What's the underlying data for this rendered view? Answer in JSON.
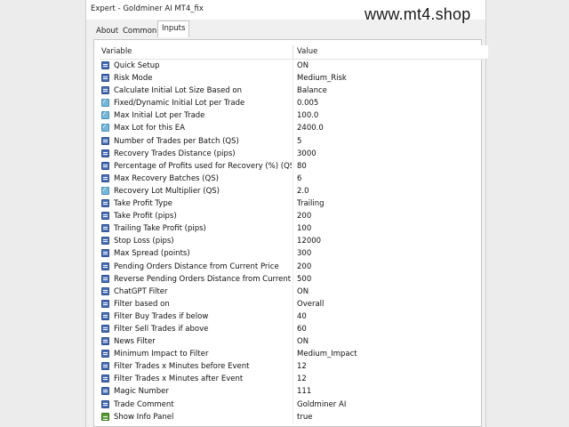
{
  "window": {
    "title": "Expert - Goldminer AI MT4_fix"
  },
  "watermark": "www.mt4.shop",
  "tabs": [
    "About",
    "Common",
    "Inputs"
  ],
  "active_tab": "Inputs",
  "table": {
    "headers": [
      "Variable",
      "Value"
    ],
    "rows": [
      {
        "icon": "parameter-icon",
        "name": "Quick Setup",
        "value": "ON"
      },
      {
        "icon": "parameter-icon",
        "name": "Risk Mode",
        "value": "Medium_Risk"
      },
      {
        "icon": "parameter-icon",
        "name": "Calculate Initial Lot Size Based on",
        "value": "Balance"
      },
      {
        "icon": "double-value-icon",
        "name": "Fixed/Dynamic Initial Lot per Trade",
        "value": "0.005"
      },
      {
        "icon": "double-value-icon",
        "name": "Max Initial Lot per Trade",
        "value": "100.0"
      },
      {
        "icon": "double-value-icon",
        "name": "Max Lot for this EA",
        "value": "2400.0"
      },
      {
        "icon": "parameter-icon",
        "name": "Number of Trades per Batch (QS)",
        "value": "5"
      },
      {
        "icon": "parameter-icon",
        "name": "Recovery Trades Distance (pips)",
        "value": "3000"
      },
      {
        "icon": "parameter-icon",
        "name": "Percentage of Profits used for Recovery (%) (QS)",
        "value": "80"
      },
      {
        "icon": "parameter-icon",
        "name": "Max Recovery Batches (QS)",
        "value": "6"
      },
      {
        "icon": "double-value-icon",
        "name": "Recovery Lot Multiplier (QS)",
        "value": "2.0"
      },
      {
        "icon": "parameter-icon",
        "name": "Take Profit Type",
        "value": "Trailing"
      },
      {
        "icon": "parameter-icon",
        "name": "Take Profit (pips)",
        "value": "200"
      },
      {
        "icon": "parameter-icon",
        "name": "Trailing Take Profit (pips)",
        "value": "100"
      },
      {
        "icon": "parameter-icon",
        "name": "Stop Loss (pips)",
        "value": "12000"
      },
      {
        "icon": "parameter-icon",
        "name": "Max Spread (points)",
        "value": "300"
      },
      {
        "icon": "parameter-icon",
        "name": "Pending Orders Distance from Current Price",
        "value": "200"
      },
      {
        "icon": "parameter-icon",
        "name": "Reverse Pending Orders Distance from Current Pr...",
        "value": "500"
      },
      {
        "icon": "parameter-icon",
        "name": "ChatGPT Filter",
        "value": "ON"
      },
      {
        "icon": "parameter-icon",
        "name": "Filter based on",
        "value": "Overall"
      },
      {
        "icon": "parameter-icon",
        "name": "Filter Buy Trades if below",
        "value": "40"
      },
      {
        "icon": "parameter-icon",
        "name": "Filter Sell Trades if above",
        "value": "60"
      },
      {
        "icon": "parameter-icon",
        "name": "News Filter",
        "value": "ON"
      },
      {
        "icon": "parameter-icon",
        "name": "Minimum Impact to Filter",
        "value": "Medium_Impact"
      },
      {
        "icon": "parameter-icon",
        "name": "Filter Trades x Minutes before Event",
        "value": "12"
      },
      {
        "icon": "parameter-icon",
        "name": "Filter Trades x Minutes after Event",
        "value": "12"
      },
      {
        "icon": "parameter-icon",
        "name": "Magic Number",
        "value": "111"
      },
      {
        "icon": "parameter-icon",
        "name": "Trade Comment",
        "value": "Goldminer AI"
      },
      {
        "icon": "boolean-icon",
        "name": "Show Info Panel",
        "value": "true"
      }
    ]
  }
}
